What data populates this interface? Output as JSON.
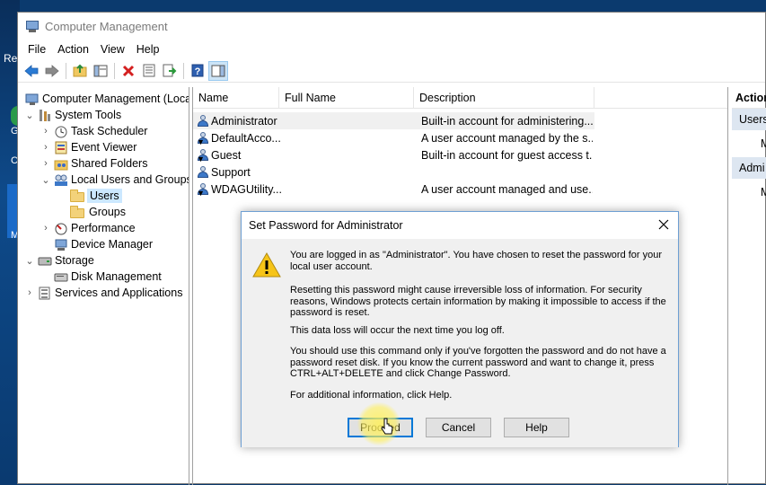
{
  "desktop": {
    "partial_label": "Re",
    "chars": [
      "G",
      "C",
      "M"
    ]
  },
  "window": {
    "title": "Computer Management"
  },
  "menu": [
    "File",
    "Action",
    "View",
    "Help"
  ],
  "toolbar_icons": [
    "back-arrow-icon",
    "forward-arrow-icon",
    "up-folder-icon",
    "show-hide-tree-icon",
    "delete-icon",
    "properties-icon",
    "export-list-icon",
    "help-icon",
    "show-hide-action-pane-icon"
  ],
  "tree": [
    {
      "label": "Computer Management (Local",
      "level": 0,
      "expander": "",
      "icon": "computer-management-icon"
    },
    {
      "label": "System Tools",
      "level": 1,
      "expander": "expanded",
      "icon": "system-tools-icon"
    },
    {
      "label": "Task Scheduler",
      "level": 2,
      "expander": "collapsed",
      "icon": "clock-icon"
    },
    {
      "label": "Event Viewer",
      "level": 2,
      "expander": "collapsed",
      "icon": "event-viewer-icon"
    },
    {
      "label": "Shared Folders",
      "level": 2,
      "expander": "collapsed",
      "icon": "shared-folder-icon"
    },
    {
      "label": "Local Users and Groups",
      "level": 2,
      "expander": "expanded",
      "icon": "users-groups-icon"
    },
    {
      "label": "Users",
      "level": 3,
      "expander": "",
      "icon": "folder-icon",
      "selected": true
    },
    {
      "label": "Groups",
      "level": 3,
      "expander": "",
      "icon": "folder-icon"
    },
    {
      "label": "Performance",
      "level": 2,
      "expander": "collapsed",
      "icon": "performance-icon"
    },
    {
      "label": "Device Manager",
      "level": 2,
      "expander": "",
      "icon": "device-manager-icon"
    },
    {
      "label": "Storage",
      "level": 1,
      "expander": "expanded",
      "icon": "storage-icon"
    },
    {
      "label": "Disk Management",
      "level": 2,
      "expander": "",
      "icon": "disk-icon"
    },
    {
      "label": "Services and Applications",
      "level": 1,
      "expander": "collapsed",
      "icon": "services-icon"
    }
  ],
  "list": {
    "columns": [
      "Name",
      "Full Name",
      "Description"
    ],
    "rows": [
      {
        "name": "Administrator",
        "full_name": "",
        "description": "Built-in account for administering...",
        "selected": true,
        "disabled": false
      },
      {
        "name": "DefaultAcco...",
        "full_name": "",
        "description": "A user account managed by the s...",
        "selected": false,
        "disabled": true
      },
      {
        "name": "Guest",
        "full_name": "",
        "description": "Built-in account for guest access t...",
        "selected": false,
        "disabled": true
      },
      {
        "name": "Support",
        "full_name": "",
        "description": "",
        "selected": false,
        "disabled": false
      },
      {
        "name": "WDAGUtility...",
        "full_name": "",
        "description": "A user account managed and use...",
        "selected": false,
        "disabled": true
      }
    ]
  },
  "actions": {
    "header": "Action",
    "sections": [
      {
        "title": "Users",
        "item": "M"
      },
      {
        "title": "Admi",
        "item": "M"
      }
    ]
  },
  "dialog": {
    "title": "Set Password for Administrator",
    "paragraphs": [
      "You are logged in as \"Administrator\". You have chosen to reset the password for your local user account.",
      "Resetting this password might cause irreversible loss of information. For security reasons, Windows protects certain information by making it impossible to access if the password is reset.",
      "This data loss will occur the next time you log off.",
      "You should use this command only if you've forgotten the password and do not have a password reset disk. If you know the current password and want to change it, press CTRL+ALT+DELETE and click Change Password.",
      "For additional information, click Help."
    ],
    "buttons": {
      "proceed": "Proceed",
      "cancel": "Cancel",
      "help": "Help"
    }
  }
}
